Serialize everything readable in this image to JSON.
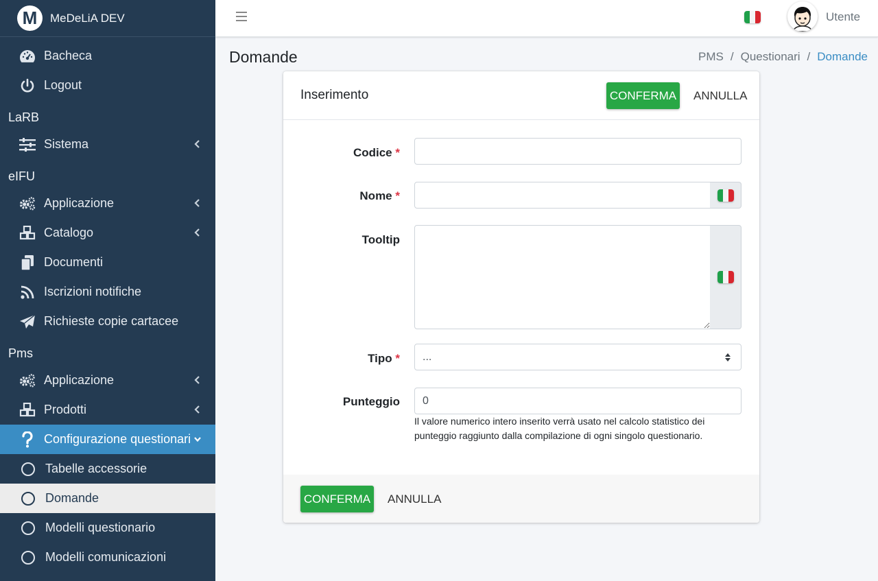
{
  "brand": {
    "logo_letter": "M",
    "name": "MeDeLiA DEV"
  },
  "sidebar": {
    "top_items": [
      {
        "label": "Bacheca",
        "icon": "dashboard-icon"
      },
      {
        "label": "Logout",
        "icon": "power-icon"
      }
    ],
    "sections": [
      {
        "header": "LaRB",
        "items": [
          {
            "label": "Sistema",
            "icon": "sliders-icon",
            "arrow": true
          }
        ]
      },
      {
        "header": "eIFU",
        "items": [
          {
            "label": "Applicazione",
            "icon": "gears-icon",
            "arrow": true
          },
          {
            "label": "Catalogo",
            "icon": "cubes-icon",
            "arrow": true
          },
          {
            "label": "Documenti",
            "icon": "copy-icon"
          },
          {
            "label": "Iscrizioni notifiche",
            "icon": "rss-icon"
          },
          {
            "label": "Richieste copie cartacee",
            "icon": "paper-plane-icon"
          }
        ]
      },
      {
        "header": "Pms",
        "items": [
          {
            "label": "Applicazione",
            "icon": "gears-icon",
            "arrow": true
          },
          {
            "label": "Prodotti",
            "icon": "cubes-icon",
            "arrow": true
          },
          {
            "label": "Configurazione questionari",
            "icon": "question-icon",
            "arrow": "down",
            "active": true
          }
        ]
      }
    ],
    "sub_items": [
      {
        "label": "Tabelle accessorie"
      },
      {
        "label": "Domande",
        "current": true
      },
      {
        "label": "Modelli questionario"
      },
      {
        "label": "Modelli comunicazioni"
      }
    ]
  },
  "topbar": {
    "user_name": "Utente",
    "language_flag": "italy-flag-icon"
  },
  "page": {
    "title": "Domande",
    "breadcrumb": [
      "PMS",
      "Questionari",
      "Domande"
    ],
    "separator": "/"
  },
  "card": {
    "title": "Inserimento",
    "confirm_label": "CONFERMA",
    "cancel_label": "ANNULLA",
    "required_mark": "*",
    "fields": {
      "codice": {
        "label": "Codice",
        "value": ""
      },
      "nome": {
        "label": "Nome",
        "value": ""
      },
      "tooltip": {
        "label": "Tooltip",
        "value": ""
      },
      "tipo": {
        "label": "Tipo",
        "value": "..."
      },
      "punteggio": {
        "label": "Punteggio",
        "value": "0",
        "help": "Il valore numerico intero inserito verrà usato nel calcolo statistico dei punteggio raggiunto dalla compilazione di ogni singolo questionario."
      }
    }
  },
  "colors": {
    "sidebar_bg": "#243b52",
    "active_bg": "#3a8dc4",
    "confirm_bg": "#28a745",
    "required": "#dc3545"
  }
}
